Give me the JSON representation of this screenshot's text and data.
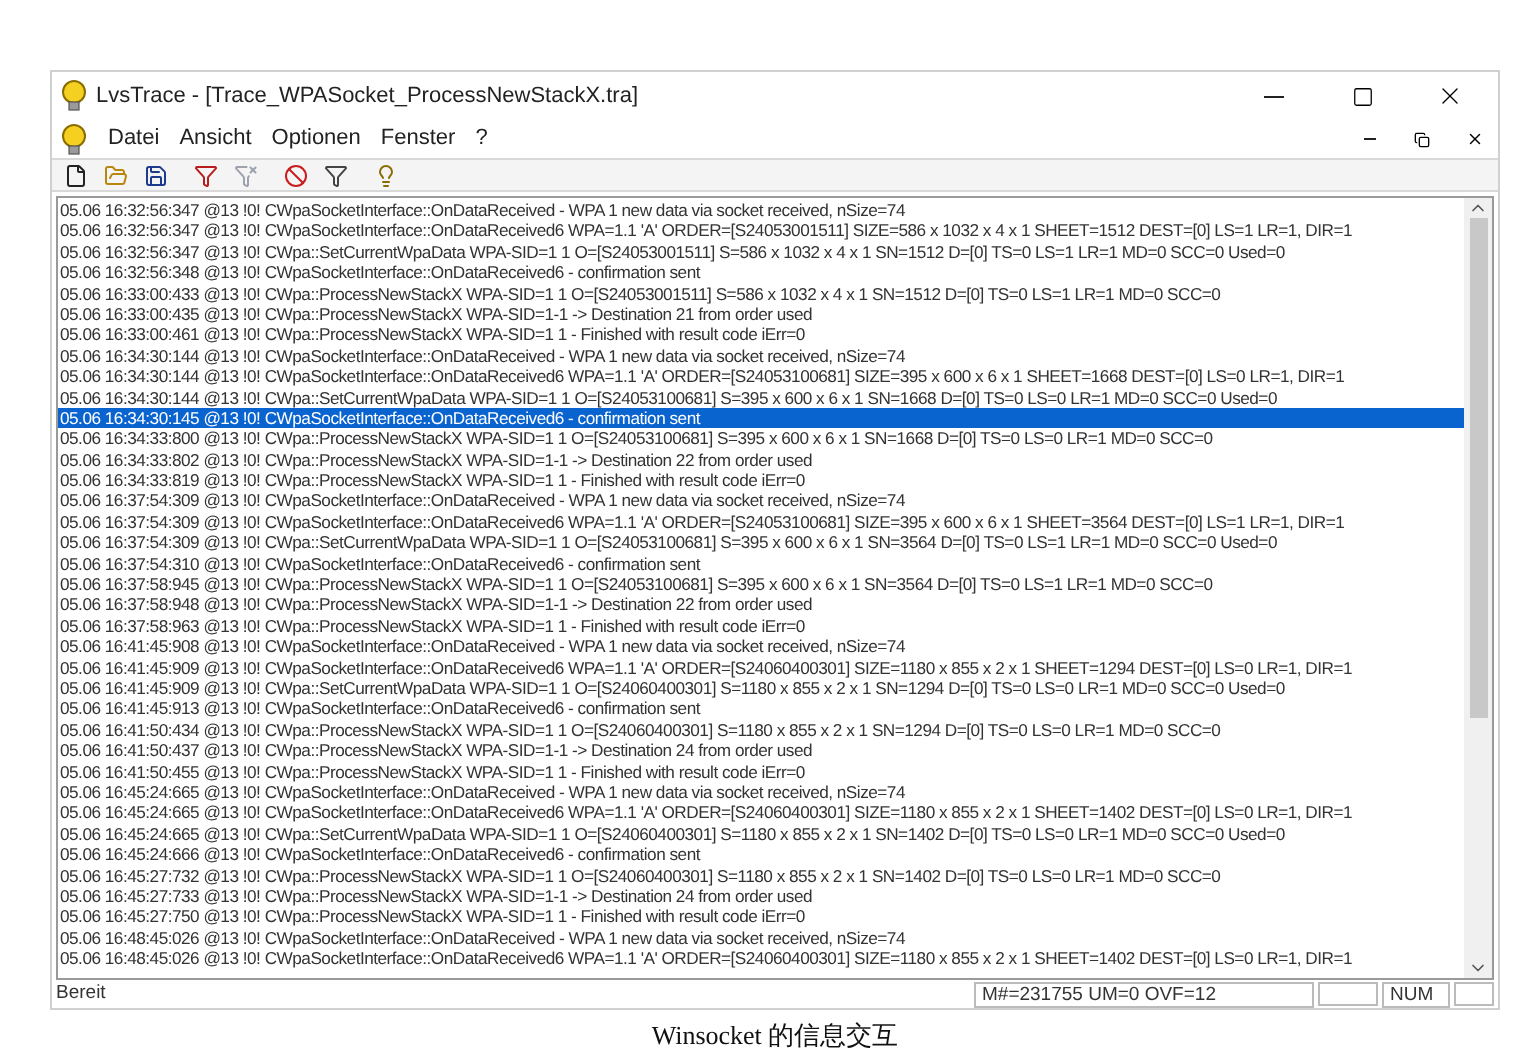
{
  "window": {
    "title": "LvsTrace - [Trace_WPASocket_ProcessNewStackX.tra]"
  },
  "menu": [
    "Datei",
    "Ansicht",
    "Optionen",
    "Fenster",
    "?"
  ],
  "log": [
    {
      "text": "05.06 16:32:56:347 @13 !0! CWpaSocketInterface::OnDataReceived - WPA 1 new data via socket received, nSize=74",
      "selected": false
    },
    {
      "text": "05.06 16:32:56:347 @13 !0! CWpaSocketInterface::OnDataReceived6 WPA=1.1 'A' ORDER=[S24053001511] SIZE=586 x 1032 x 4 x 1 SHEET=1512 DEST=[0] LS=1 LR=1, DIR=1",
      "selected": false
    },
    {
      "text": "05.06 16:32:56:347 @13 !0! CWpa::SetCurrentWpaData WPA-SID=1 1 O=[S24053001511] S=586 x 1032 x 4 x 1 SN=1512 D=[0] TS=0 LS=1 LR=1 MD=0 SCC=0 Used=0",
      "selected": false
    },
    {
      "text": "05.06 16:32:56:348 @13 !0! CWpaSocketInterface::OnDataReceived6 - confirmation sent",
      "selected": false
    },
    {
      "text": "05.06 16:33:00:433 @13 !0! CWpa::ProcessNewStackX WPA-SID=1 1 O=[S24053001511] S=586 x 1032 x 4 x 1 SN=1512 D=[0] TS=0 LS=1 LR=1 MD=0 SCC=0",
      "selected": false
    },
    {
      "text": "05.06 16:33:00:435 @13 !0! CWpa::ProcessNewStackX WPA-SID=1-1 -> Destination 21 from order used",
      "selected": false
    },
    {
      "text": "05.06 16:33:00:461 @13 !0! CWpa::ProcessNewStackX WPA-SID=1 1 - Finished with result code iErr=0",
      "selected": false
    },
    {
      "text": "05.06 16:34:30:144 @13 !0! CWpaSocketInterface::OnDataReceived - WPA 1 new data via socket received, nSize=74",
      "selected": false
    },
    {
      "text": "05.06 16:34:30:144 @13 !0! CWpaSocketInterface::OnDataReceived6 WPA=1.1 'A' ORDER=[S24053100681] SIZE=395 x 600 x 6 x 1 SHEET=1668 DEST=[0] LS=0 LR=1, DIR=1",
      "selected": false
    },
    {
      "text": "05.06 16:34:30:144 @13 !0! CWpa::SetCurrentWpaData WPA-SID=1 1 O=[S24053100681] S=395 x 600 x 6 x 1 SN=1668 D=[0] TS=0 LS=0 LR=1 MD=0 SCC=0 Used=0",
      "selected": false
    },
    {
      "text": "05.06 16:34:30:145 @13 !0! CWpaSocketInterface::OnDataReceived6 - confirmation sent",
      "selected": true
    },
    {
      "text": "05.06 16:34:33:800 @13 !0! CWpa::ProcessNewStackX WPA-SID=1 1 O=[S24053100681] S=395 x 600 x 6 x 1 SN=1668 D=[0] TS=0 LS=0 LR=1 MD=0 SCC=0",
      "selected": false
    },
    {
      "text": "05.06 16:34:33:802 @13 !0! CWpa::ProcessNewStackX WPA-SID=1-1 -> Destination 22 from order used",
      "selected": false
    },
    {
      "text": "05.06 16:34:33:819 @13 !0! CWpa::ProcessNewStackX WPA-SID=1 1 - Finished with result code iErr=0",
      "selected": false
    },
    {
      "text": "05.06 16:37:54:309 @13 !0! CWpaSocketInterface::OnDataReceived - WPA 1 new data via socket received, nSize=74",
      "selected": false
    },
    {
      "text": "05.06 16:37:54:309 @13 !0! CWpaSocketInterface::OnDataReceived6 WPA=1.1 'A' ORDER=[S24053100681] SIZE=395 x 600 x 6 x 1 SHEET=3564 DEST=[0] LS=1 LR=1, DIR=1",
      "selected": false
    },
    {
      "text": "05.06 16:37:54:309 @13 !0! CWpa::SetCurrentWpaData WPA-SID=1 1 O=[S24053100681] S=395 x 600 x 6 x 1 SN=3564 D=[0] TS=0 LS=1 LR=1 MD=0 SCC=0 Used=0",
      "selected": false
    },
    {
      "text": "05.06 16:37:54:310 @13 !0! CWpaSocketInterface::OnDataReceived6 - confirmation sent",
      "selected": false
    },
    {
      "text": "05.06 16:37:58:945 @13 !0! CWpa::ProcessNewStackX WPA-SID=1 1 O=[S24053100681] S=395 x 600 x 6 x 1 SN=3564 D=[0] TS=0 LS=1 LR=1 MD=0 SCC=0",
      "selected": false
    },
    {
      "text": "05.06 16:37:58:948 @13 !0! CWpa::ProcessNewStackX WPA-SID=1-1 -> Destination 22 from order used",
      "selected": false
    },
    {
      "text": "05.06 16:37:58:963 @13 !0! CWpa::ProcessNewStackX WPA-SID=1 1 - Finished with result code iErr=0",
      "selected": false
    },
    {
      "text": "05.06 16:41:45:908 @13 !0! CWpaSocketInterface::OnDataReceived - WPA 1 new data via socket received, nSize=74",
      "selected": false
    },
    {
      "text": "05.06 16:41:45:909 @13 !0! CWpaSocketInterface::OnDataReceived6 WPA=1.1 'A' ORDER=[S24060400301] SIZE=1180 x 855 x 2 x 1 SHEET=1294 DEST=[0] LS=0 LR=1, DIR=1",
      "selected": false
    },
    {
      "text": "05.06 16:41:45:909 @13 !0! CWpa::SetCurrentWpaData WPA-SID=1 1 O=[S24060400301] S=1180 x 855 x 2 x 1 SN=1294 D=[0] TS=0 LS=0 LR=1 MD=0 SCC=0 Used=0",
      "selected": false
    },
    {
      "text": "05.06 16:41:45:913 @13 !0! CWpaSocketInterface::OnDataReceived6 - confirmation sent",
      "selected": false
    },
    {
      "text": "05.06 16:41:50:434 @13 !0! CWpa::ProcessNewStackX WPA-SID=1 1 O=[S24060400301] S=1180 x 855 x 2 x 1 SN=1294 D=[0] TS=0 LS=0 LR=1 MD=0 SCC=0",
      "selected": false
    },
    {
      "text": "05.06 16:41:50:437 @13 !0! CWpa::ProcessNewStackX WPA-SID=1-1 -> Destination 24 from order used",
      "selected": false
    },
    {
      "text": "05.06 16:41:50:455 @13 !0! CWpa::ProcessNewStackX WPA-SID=1 1 - Finished with result code iErr=0",
      "selected": false
    },
    {
      "text": "05.06 16:45:24:665 @13 !0! CWpaSocketInterface::OnDataReceived - WPA 1 new data via socket received, nSize=74",
      "selected": false
    },
    {
      "text": "05.06 16:45:24:665 @13 !0! CWpaSocketInterface::OnDataReceived6 WPA=1.1 'A' ORDER=[S24060400301] SIZE=1180 x 855 x 2 x 1 SHEET=1402 DEST=[0] LS=0 LR=1, DIR=1",
      "selected": false
    },
    {
      "text": "05.06 16:45:24:665 @13 !0! CWpa::SetCurrentWpaData WPA-SID=1 1 O=[S24060400301] S=1180 x 855 x 2 x 1 SN=1402 D=[0] TS=0 LS=0 LR=1 MD=0 SCC=0 Used=0",
      "selected": false
    },
    {
      "text": "05.06 16:45:24:666 @13 !0! CWpaSocketInterface::OnDataReceived6 - confirmation sent",
      "selected": false
    },
    {
      "text": "05.06 16:45:27:732 @13 !0! CWpa::ProcessNewStackX WPA-SID=1 1 O=[S24060400301] S=1180 x 855 x 2 x 1 SN=1402 D=[0] TS=0 LS=0 LR=1 MD=0 SCC=0",
      "selected": false
    },
    {
      "text": "05.06 16:45:27:733 @13 !0! CWpa::ProcessNewStackX WPA-SID=1-1 -> Destination 24 from order used",
      "selected": false
    },
    {
      "text": "05.06 16:45:27:750 @13 !0! CWpa::ProcessNewStackX WPA-SID=1 1 - Finished with result code iErr=0",
      "selected": false
    },
    {
      "text": "05.06 16:48:45:026 @13 !0! CWpaSocketInterface::OnDataReceived - WPA 1 new data via socket received, nSize=74",
      "selected": false
    },
    {
      "text": "05.06 16:48:45:026 @13 !0! CWpaSocketInterface::OnDataReceived6 WPA=1.1 'A' ORDER=[S24060400301] SIZE=1180 x 855 x 2 x 1 SHEET=1402 DEST=[0] LS=0 LR=1, DIR=1",
      "selected": false
    }
  ],
  "status_bar": {
    "text": "Bereit",
    "counters": "M#=231755 UM=0 OVF=12",
    "num": "NUM"
  },
  "caption": "Winsocket 的信息交互"
}
